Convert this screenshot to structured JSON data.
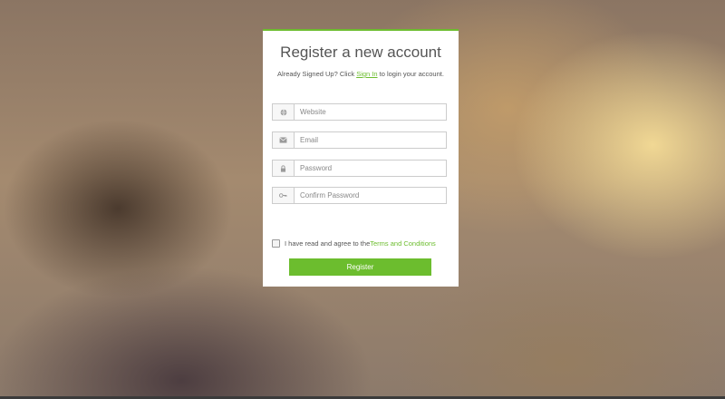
{
  "page": {
    "background": "blurred-bokeh",
    "accent_color": "#6cbd2e"
  },
  "form": {
    "title": "Register a new account",
    "signin_prefix": "Already Signed Up? Click ",
    "signin_link": "Sign In",
    "signin_suffix": " to login your account.",
    "fields": [
      {
        "name": "website",
        "placeholder": "Website",
        "icon": "globe-icon"
      },
      {
        "name": "email",
        "placeholder": "Email",
        "icon": "envelope-icon"
      },
      {
        "name": "password",
        "placeholder": "Password",
        "icon": "lock-icon"
      },
      {
        "name": "confirm_password",
        "placeholder": "Confirm Password",
        "icon": "key-icon"
      }
    ],
    "agree_prefix": "I have read and agree to the ",
    "agree_link": "Terms and Conditions",
    "agree_checked": false,
    "submit_label": "Register"
  }
}
